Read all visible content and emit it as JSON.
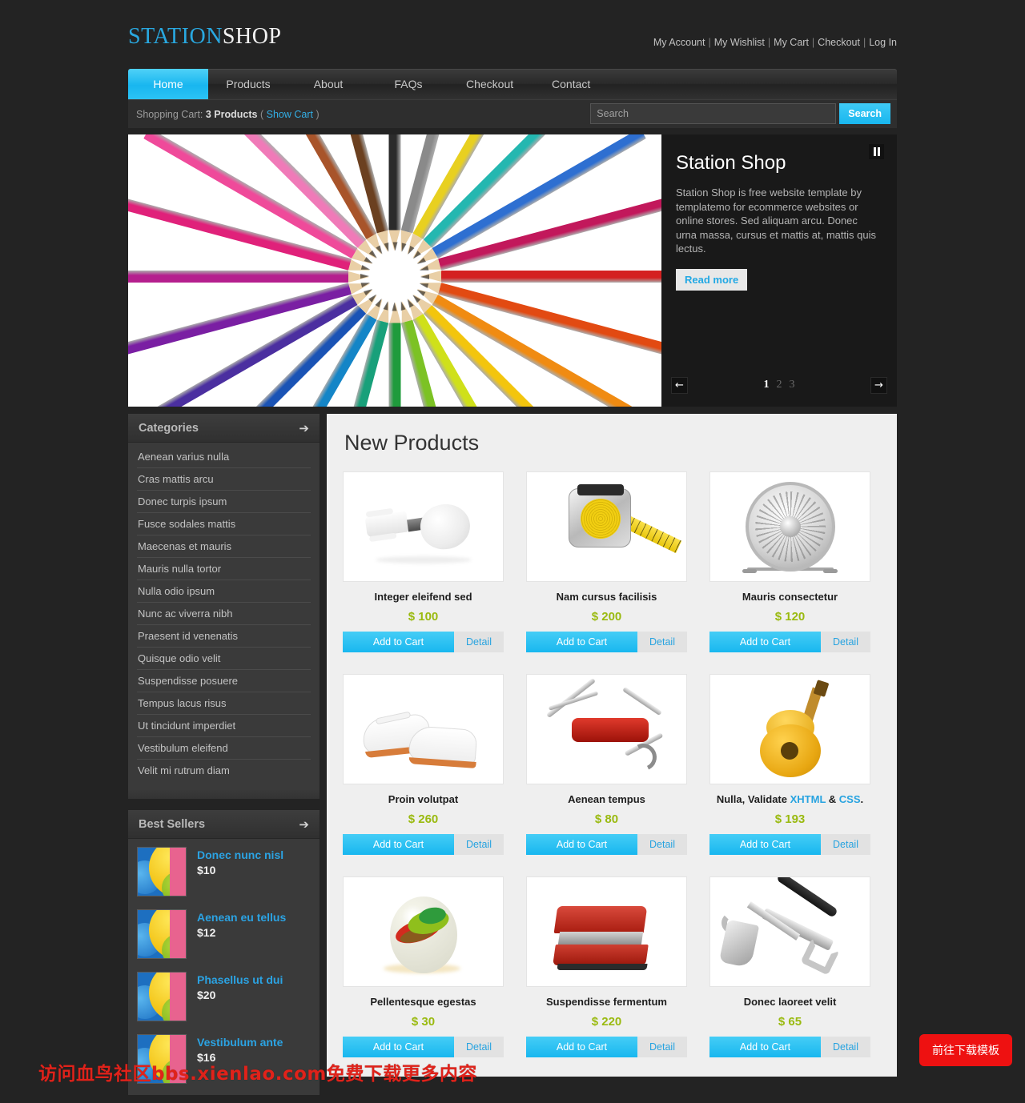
{
  "site": {
    "logo_first": "STATION",
    "logo_second": "SHOP"
  },
  "toplinks": [
    {
      "label": "My Account"
    },
    {
      "label": "My Wishlist"
    },
    {
      "label": "My Cart"
    },
    {
      "label": "Checkout"
    },
    {
      "label": "Log In"
    }
  ],
  "nav": [
    {
      "label": "Home",
      "active": true
    },
    {
      "label": "Products",
      "active": false
    },
    {
      "label": "About",
      "active": false
    },
    {
      "label": "FAQs",
      "active": false
    },
    {
      "label": "Checkout",
      "active": false
    },
    {
      "label": "Contact",
      "active": false
    }
  ],
  "cartbar": {
    "prefix": "Shopping Cart:",
    "count": "3 Products",
    "paren_open": "(",
    "show_cart": "Show Cart",
    "paren_close": ")"
  },
  "search": {
    "placeholder": "Search",
    "value": "",
    "button": "Search"
  },
  "slider": {
    "title": "Station Shop",
    "body": "Station Shop is free website template by templatemo for ecommerce websites or online stores. Sed aliquam arcu. Donec urna massa, cursus et mattis at, mattis quis lectus.",
    "read_more": "Read more",
    "pages": [
      "1",
      "2",
      "3"
    ],
    "active_page": "1",
    "prev": "←",
    "next": "→"
  },
  "sidebar": {
    "categories": {
      "title": "Categories",
      "arrow": "➔",
      "items": [
        {
          "label": "Aenean varius nulla"
        },
        {
          "label": "Cras mattis arcu"
        },
        {
          "label": "Donec turpis ipsum"
        },
        {
          "label": "Fusce sodales mattis"
        },
        {
          "label": "Maecenas et mauris"
        },
        {
          "label": "Mauris nulla tortor"
        },
        {
          "label": "Nulla odio ipsum"
        },
        {
          "label": "Nunc ac viverra nibh"
        },
        {
          "label": "Praesent id venenatis"
        },
        {
          "label": "Quisque odio velit"
        },
        {
          "label": "Suspendisse posuere"
        },
        {
          "label": "Tempus lacus risus"
        },
        {
          "label": "Ut tincidunt imperdiet"
        },
        {
          "label": "Vestibulum eleifend"
        },
        {
          "label": "Velit mi rutrum diam"
        }
      ]
    },
    "best_sellers": {
      "title": "Best Sellers",
      "arrow": "➔",
      "items": [
        {
          "name": "Donec nunc nisl",
          "price": "$10"
        },
        {
          "name": "Aenean eu tellus",
          "price": "$12"
        },
        {
          "name": "Phasellus ut dui",
          "price": "$20"
        },
        {
          "name": "Vestibulum ante",
          "price": "$16"
        }
      ]
    }
  },
  "products": {
    "heading": "New Products",
    "cart_label": "Add to Cart",
    "detail_label": "Detail",
    "items": [
      {
        "name": "Integer eleifend sed",
        "price": "$ 100",
        "art": "bulb"
      },
      {
        "name": "Nam cursus facilisis",
        "price": "$ 200",
        "art": "tape"
      },
      {
        "name": "Mauris consectetur",
        "price": "$ 120",
        "art": "fan"
      },
      {
        "name": "Proin volutpat",
        "price": "$ 260",
        "art": "shoes"
      },
      {
        "name": "Aenean tempus",
        "price": "$ 80",
        "art": "knife"
      },
      {
        "name": "Nulla, Validate XHTML & CSS.",
        "name_pre": "Nulla, Validate ",
        "link1": "XHTML",
        "name_mid": " & ",
        "link2": "CSS",
        "name_post": ".",
        "price": "$ 193",
        "art": "guitar"
      },
      {
        "name": "Pellentesque egestas",
        "price": "$ 30",
        "art": "marble"
      },
      {
        "name": "Suspendisse fermentum",
        "price": "$ 220",
        "art": "stapler"
      },
      {
        "name": "Donec laoreet velit",
        "price": "$ 65",
        "art": "tools"
      }
    ]
  },
  "overlay": {
    "watermark": "访问血鸟社区bbs.xienlao.com免费下载更多内容",
    "download_button": "前往下载模板"
  },
  "colors": {
    "accent": "#1fb8ef",
    "price": "#9aba10",
    "link": "#27a3e0",
    "red": "#ee1111"
  }
}
